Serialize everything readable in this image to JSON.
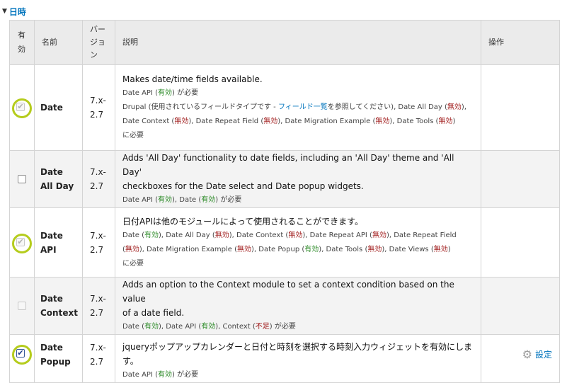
{
  "section": {
    "title": "日時"
  },
  "table": {
    "headers": {
      "enabled": [
        "有",
        "効"
      ],
      "name": "名前",
      "version": [
        "バー",
        "ジョ",
        "ン"
      ],
      "description": "説明",
      "operations": "操作"
    },
    "rows": [
      {
        "name": [
          "Date"
        ],
        "version": [
          "7.x-",
          "2.7"
        ],
        "checkbox_state": "checked-disabled",
        "description": "Makes date/time fields available.",
        "requires_prefix": "Date API",
        "requires_status": "有効",
        "requires_suffix": "が必要",
        "required_by": {
          "a": "Drupal (",
          "b": "使用されているフィールドタイプです - ",
          "link": "フィールド一覧",
          "c": "を参照してください), Date All Day (",
          "s1": "無効",
          "d": "),",
          "e": "Date Context (",
          "s2": "無効",
          "f": "), Date Repeat Field (",
          "s3": "無効",
          "g": "), Date Migration Example (",
          "s4": "無効",
          "h": "), Date Tools (",
          "s5": "無効",
          "i": ")",
          "j": "に必要"
        }
      },
      {
        "name": [
          "Date",
          "All Day"
        ],
        "version": [
          "7.x-",
          "2.7"
        ],
        "checkbox_state": "unchecked",
        "description_lines": [
          "Adds 'All Day' functionality to date fields, including an 'All Day' theme and 'All Day'",
          "checkboxes for the Date select and Date popup widgets."
        ],
        "req": {
          "a": "Date API (",
          "s1": "有効",
          "b": "), Date (",
          "s2": "有効",
          "c": ") が必要"
        }
      },
      {
        "name": [
          "Date",
          "API"
        ],
        "version": [
          "7.x-",
          "2.7"
        ],
        "checkbox_state": "checked-disabled",
        "description": "日付APIは他のモジュールによって使用されることができます。",
        "required_by": {
          "a": "Date (",
          "s1": "有効",
          "b": "), Date All Day (",
          "s2": "無効",
          "c": "), Date Context (",
          "s3": "無効",
          "d": "), Date Repeat API (",
          "s4": "無効",
          "e": "), Date Repeat Field",
          "f": "(",
          "s5": "無効",
          "g": "), Date Migration Example (",
          "s6": "無効",
          "h": "), Date Popup (",
          "s7": "有効",
          "i": "), Date Tools (",
          "s8": "無効",
          "j": "), Date Views (",
          "s9": "無効",
          "k": ")",
          "l": "に必要"
        }
      },
      {
        "name": [
          "Date",
          "Context"
        ],
        "version": [
          "7.x-",
          "2.7"
        ],
        "checkbox_state": "disabled",
        "description_lines": [
          "Adds an option to the Context module to set a context condition based on the value",
          "of a date field."
        ],
        "req": {
          "a": "Date (",
          "s1": "有効",
          "b": "), Date API (",
          "s2": "有効",
          "c": "), Context (",
          "s3": "不足",
          "d": ") が必要"
        }
      },
      {
        "name": [
          "Date",
          "Popup"
        ],
        "version": [
          "7.x-",
          "2.7"
        ],
        "checkbox_state": "checked",
        "description": "jqueryポップアップカレンダーと日付と時刻を選択する時刻入力ウィジェットを有効にします。",
        "req": {
          "a": "Date API (",
          "s1": "有効",
          "b": ") が必要"
        },
        "operation": "設定"
      }
    ]
  },
  "colors": {
    "link": "#0074bd",
    "enabled_status": "#2b8a26",
    "disabled_status": "#a01a1a",
    "highlight_ring": "#b5cc1d"
  },
  "icons": {
    "collapse": "triangle-down-icon",
    "check": "checkmark-icon",
    "configure": "gear-icon"
  }
}
